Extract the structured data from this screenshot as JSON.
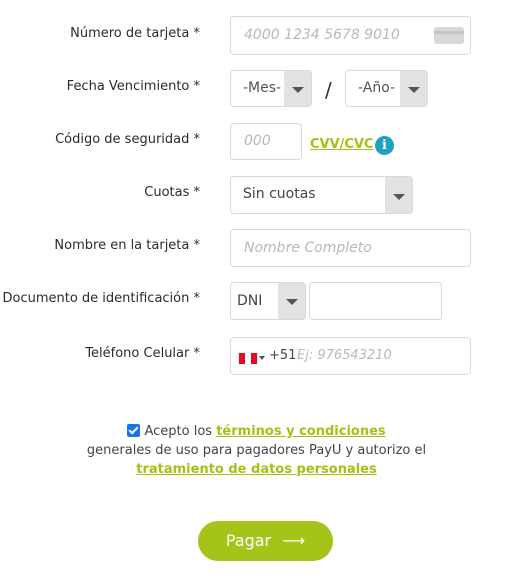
{
  "form": {
    "card_number": {
      "label": "Número de tarjeta *",
      "placeholder": "4000 1234 5678 9010",
      "icon": "credit-card-icon"
    },
    "expiry": {
      "label": "Fecha Vencimiento *",
      "month": "-Mes-",
      "separator": "/",
      "year": "-Año-"
    },
    "security_code": {
      "label": "Código de seguridad *",
      "placeholder": "000",
      "help_link": "CVV/CVC",
      "info_icon": "info-icon"
    },
    "installments": {
      "label": "Cuotas *",
      "value": "Sin cuotas"
    },
    "card_name": {
      "label": "Nombre en la tarjeta *",
      "placeholder": "Nombre Completo"
    },
    "document": {
      "label": "Documento de identificación *",
      "type": "DNI",
      "value": ""
    },
    "phone": {
      "label": "Teléfono Celular *",
      "country_code": "+51",
      "placeholder": "Ej: 976543210",
      "flag": "peru-flag-icon"
    }
  },
  "terms": {
    "checked": true,
    "prefix": "Acepto los",
    "link1": "términos y condiciones",
    "middle": "generales de uso para pagadores PayU y autorizo el",
    "link2": "tratamiento de datos personales"
  },
  "submit": {
    "label": "Pagar",
    "arrow": "⟶"
  },
  "colors": {
    "accent": "#a3c214",
    "button": "#a5c419",
    "info": "#1fa0c7",
    "border": "#d9d9d9"
  }
}
